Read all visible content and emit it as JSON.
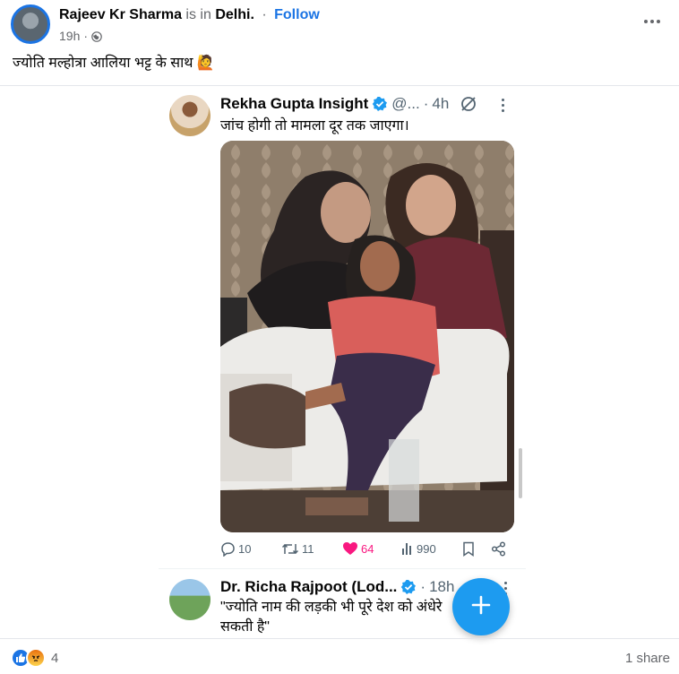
{
  "post": {
    "author": "Rajeev Kr Sharma",
    "is_in": "is in",
    "location": "Delhi.",
    "separator": "·",
    "follow_label": "Follow",
    "time": "19h",
    "time_separator": "·",
    "text": "ज्योति मल्होत्रा आलिया भट्ट के साथ",
    "emoji": "🙋"
  },
  "tweet": {
    "name": "Rekha Gupta Insight",
    "handle": "@...",
    "time_separator": "·",
    "time": "4h",
    "text": "जांच होगी तो मामला दूर तक जाएगा।",
    "actions": {
      "replies": "10",
      "retweets": "11",
      "likes": "64",
      "views": "990"
    }
  },
  "reply": {
    "name": "Dr. Richa Rajpoot (Lod...",
    "time_separator": "·",
    "time": "18h",
    "text": "\"ज्योति नाम की लड़की भी पूरे देश को अंधेरे सकती है\""
  },
  "footer": {
    "reaction_count": "4",
    "shares": "1 share"
  },
  "colors": {
    "facebook_blue": "#1b74e4",
    "twitter_blue": "#1d9bf0",
    "like_pink": "#f91880",
    "muted_text": "#65676b"
  },
  "icons": [
    "globe-icon",
    "more-horizontal-icon",
    "verified-icon",
    "grok-icon",
    "reply-icon",
    "retweet-icon",
    "heart-icon",
    "views-icon",
    "bookmark-icon",
    "share-icon",
    "plus-icon",
    "like-reaction-icon",
    "angry-reaction-icon"
  ]
}
